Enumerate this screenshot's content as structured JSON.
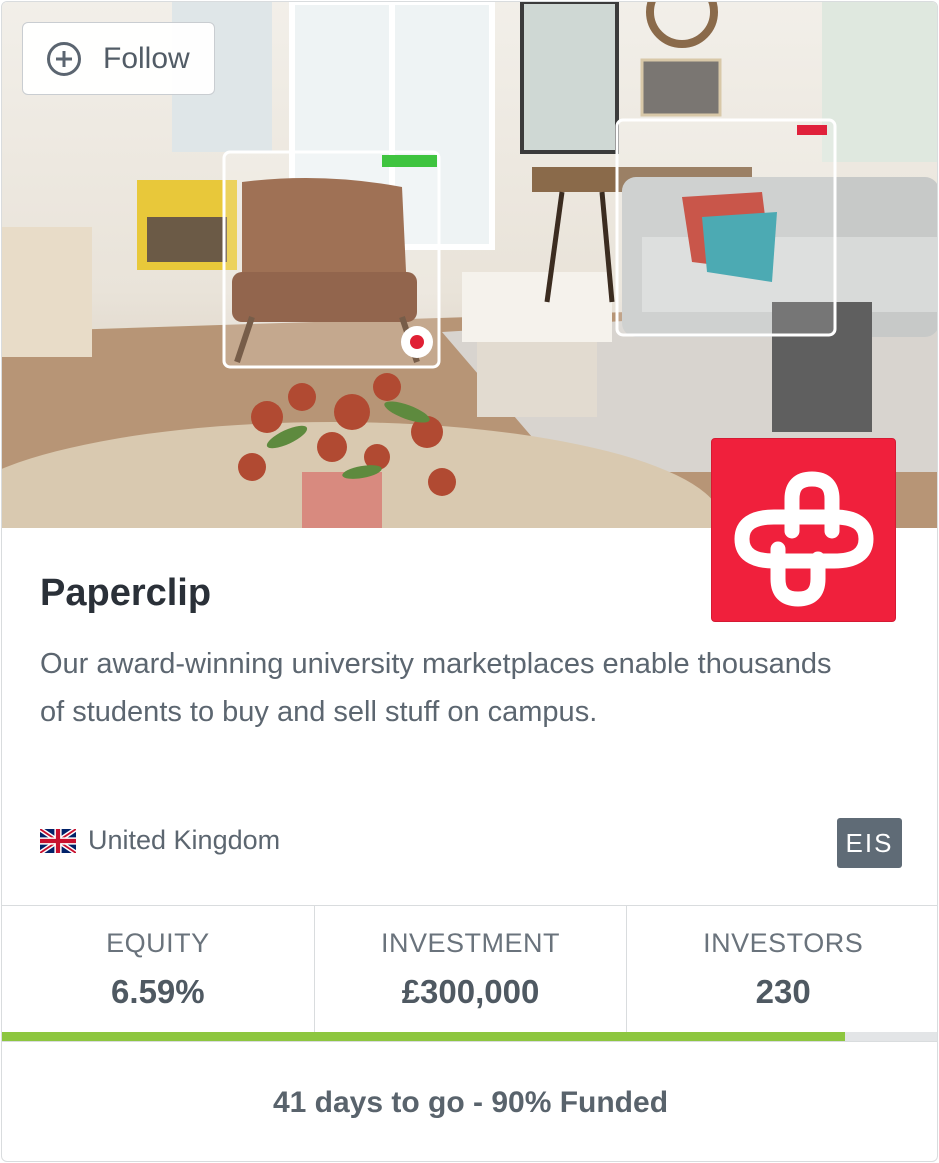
{
  "follow_button": {
    "label": "Follow",
    "icon": "plus-circle-icon"
  },
  "company": {
    "name": "Paperclip",
    "description": "Our award-winning university marketplaces enable thousands of students to buy and sell stuff on campus.",
    "logo_color": "#f0203c"
  },
  "location": {
    "country": "United Kingdom",
    "flag_icon": "uk-flag-icon"
  },
  "badge": "EIS",
  "stats": [
    {
      "label": "EQUITY",
      "value": "6.59%"
    },
    {
      "label": "INVESTMENT",
      "value": "£300,000"
    },
    {
      "label": "INVESTORS",
      "value": "230"
    }
  ],
  "progress": {
    "funded_fraction": 0.9,
    "color": "#8dc63f"
  },
  "footer": {
    "status": "41 days to go - 90% Funded"
  }
}
